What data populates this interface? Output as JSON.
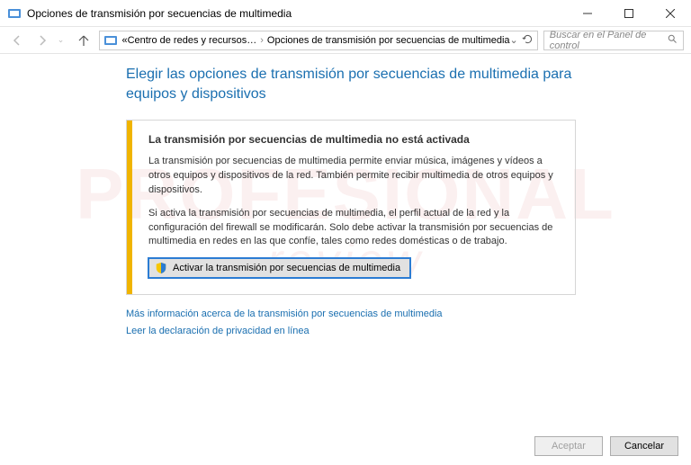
{
  "window": {
    "title": "Opciones de transmisión por secuencias de multimedia"
  },
  "breadcrumb": {
    "prefix": "«",
    "seg1": "Centro de redes y recursos…",
    "seg2": "Opciones de transmisión por secuencias de multimedia"
  },
  "search": {
    "placeholder": "Buscar en el Panel de control"
  },
  "page": {
    "heading": "Elegir las opciones de transmisión por secuencias de multimedia para equipos y dispositivos"
  },
  "info": {
    "title": "La transmisión por secuencias de multimedia no está activada",
    "p1": "La transmisión por secuencias de multimedia permite enviar música, imágenes y vídeos a otros equipos y dispositivos de la red. También permite recibir multimedia de otros equipos y dispositivos.",
    "p2": "Si activa la transmisión por secuencias de multimedia, el perfil actual de la red y la configuración del firewall se modificarán. Solo debe activar la transmisión por secuencias de multimedia en redes en las que confíe, tales como redes domésticas o de trabajo.",
    "button": "Activar la transmisión por secuencias de multimedia"
  },
  "links": {
    "more": "Más información acerca de la transmisión por secuencias de multimedia",
    "privacy": "Leer la declaración de privacidad en línea"
  },
  "footer": {
    "ok": "Aceptar",
    "cancel": "Cancelar"
  }
}
